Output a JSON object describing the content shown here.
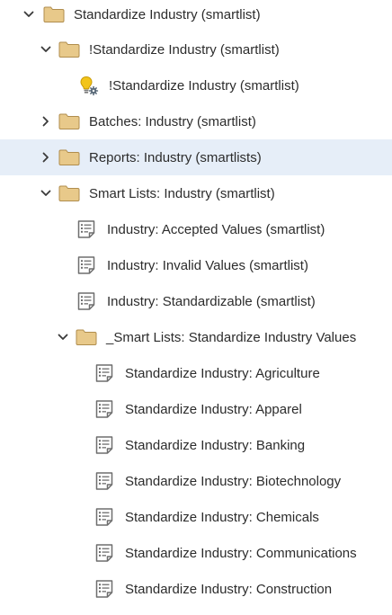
{
  "colors": {
    "folder_fill": "#e8c98a",
    "folder_stroke": "#b08d4d",
    "smartlist_icon": "#6e6e6e",
    "selected_row": "#e6eef8",
    "bulb": "#f2c41a"
  },
  "tree": {
    "root": {
      "label": "Standardize Industry (smartlist)",
      "icon": "folder-icon",
      "expanded": true
    },
    "sub_standardize": {
      "label": "!Standardize Industry (smartlist)",
      "icon": "folder-icon",
      "expanded": true
    },
    "campaign_standardize": {
      "label": "!Standardize Industry (smartlist)",
      "icon": "smart-campaign-icon"
    },
    "batches": {
      "label": "Batches: Industry (smartlist)",
      "icon": "folder-icon",
      "expanded": false
    },
    "reports": {
      "label": "Reports: Industry (smartlists)",
      "icon": "folder-icon",
      "expanded": false,
      "selected": true
    },
    "smart_lists": {
      "label": "Smart Lists: Industry (smartlist)",
      "icon": "folder-icon",
      "expanded": true
    },
    "sl_accepted": {
      "label": "Industry: Accepted Values (smartlist)",
      "icon": "smart-list-icon"
    },
    "sl_invalid": {
      "label": "Industry: Invalid Values (smartlist)",
      "icon": "smart-list-icon"
    },
    "sl_standardizable": {
      "label": "Industry: Standardizable (smartlist)",
      "icon": "smart-list-icon"
    },
    "sub_values": {
      "label": "_Smart Lists: Standardize Industry Values",
      "icon": "folder-icon",
      "expanded": true
    },
    "values": [
      {
        "label": "Standardize Industry: Agriculture",
        "icon": "smart-list-icon"
      },
      {
        "label": "Standardize Industry: Apparel",
        "icon": "smart-list-icon"
      },
      {
        "label": "Standardize Industry: Banking",
        "icon": "smart-list-icon"
      },
      {
        "label": "Standardize Industry: Biotechnology",
        "icon": "smart-list-icon"
      },
      {
        "label": "Standardize Industry: Chemicals",
        "icon": "smart-list-icon"
      },
      {
        "label": "Standardize Industry: Communications",
        "icon": "smart-list-icon"
      },
      {
        "label": "Standardize Industry: Construction",
        "icon": "smart-list-icon"
      }
    ]
  }
}
